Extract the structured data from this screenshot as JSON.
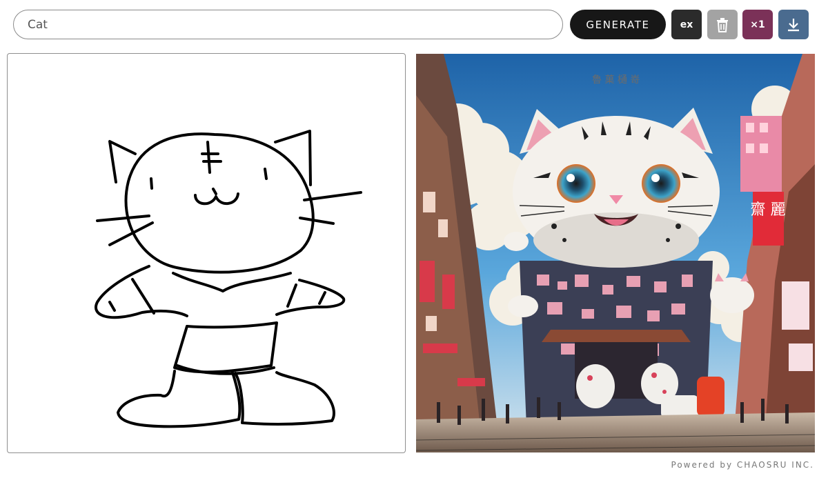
{
  "prompt": {
    "value": "Cat"
  },
  "toolbar": {
    "generate_label": "GENERATE",
    "ex_label": "ex",
    "count_label": "×1",
    "trash_icon": "trash-icon",
    "download_icon": "download-icon"
  },
  "sketch": {
    "subject": "hand-drawn cat"
  },
  "result": {
    "subject": "generated anime city with giant white cat",
    "sign_text": "魯 菓 樋 嵜",
    "red_sign_text": "齋 麗"
  },
  "footer": {
    "text": "Powered by CHAOSRU INC."
  },
  "colors": {
    "generate_bg": "#171717",
    "ex_bg": "#2b2b2b",
    "trash_bg": "#a3a3a3",
    "count_bg": "#7b3158",
    "download_bg": "#4a6b8f"
  }
}
